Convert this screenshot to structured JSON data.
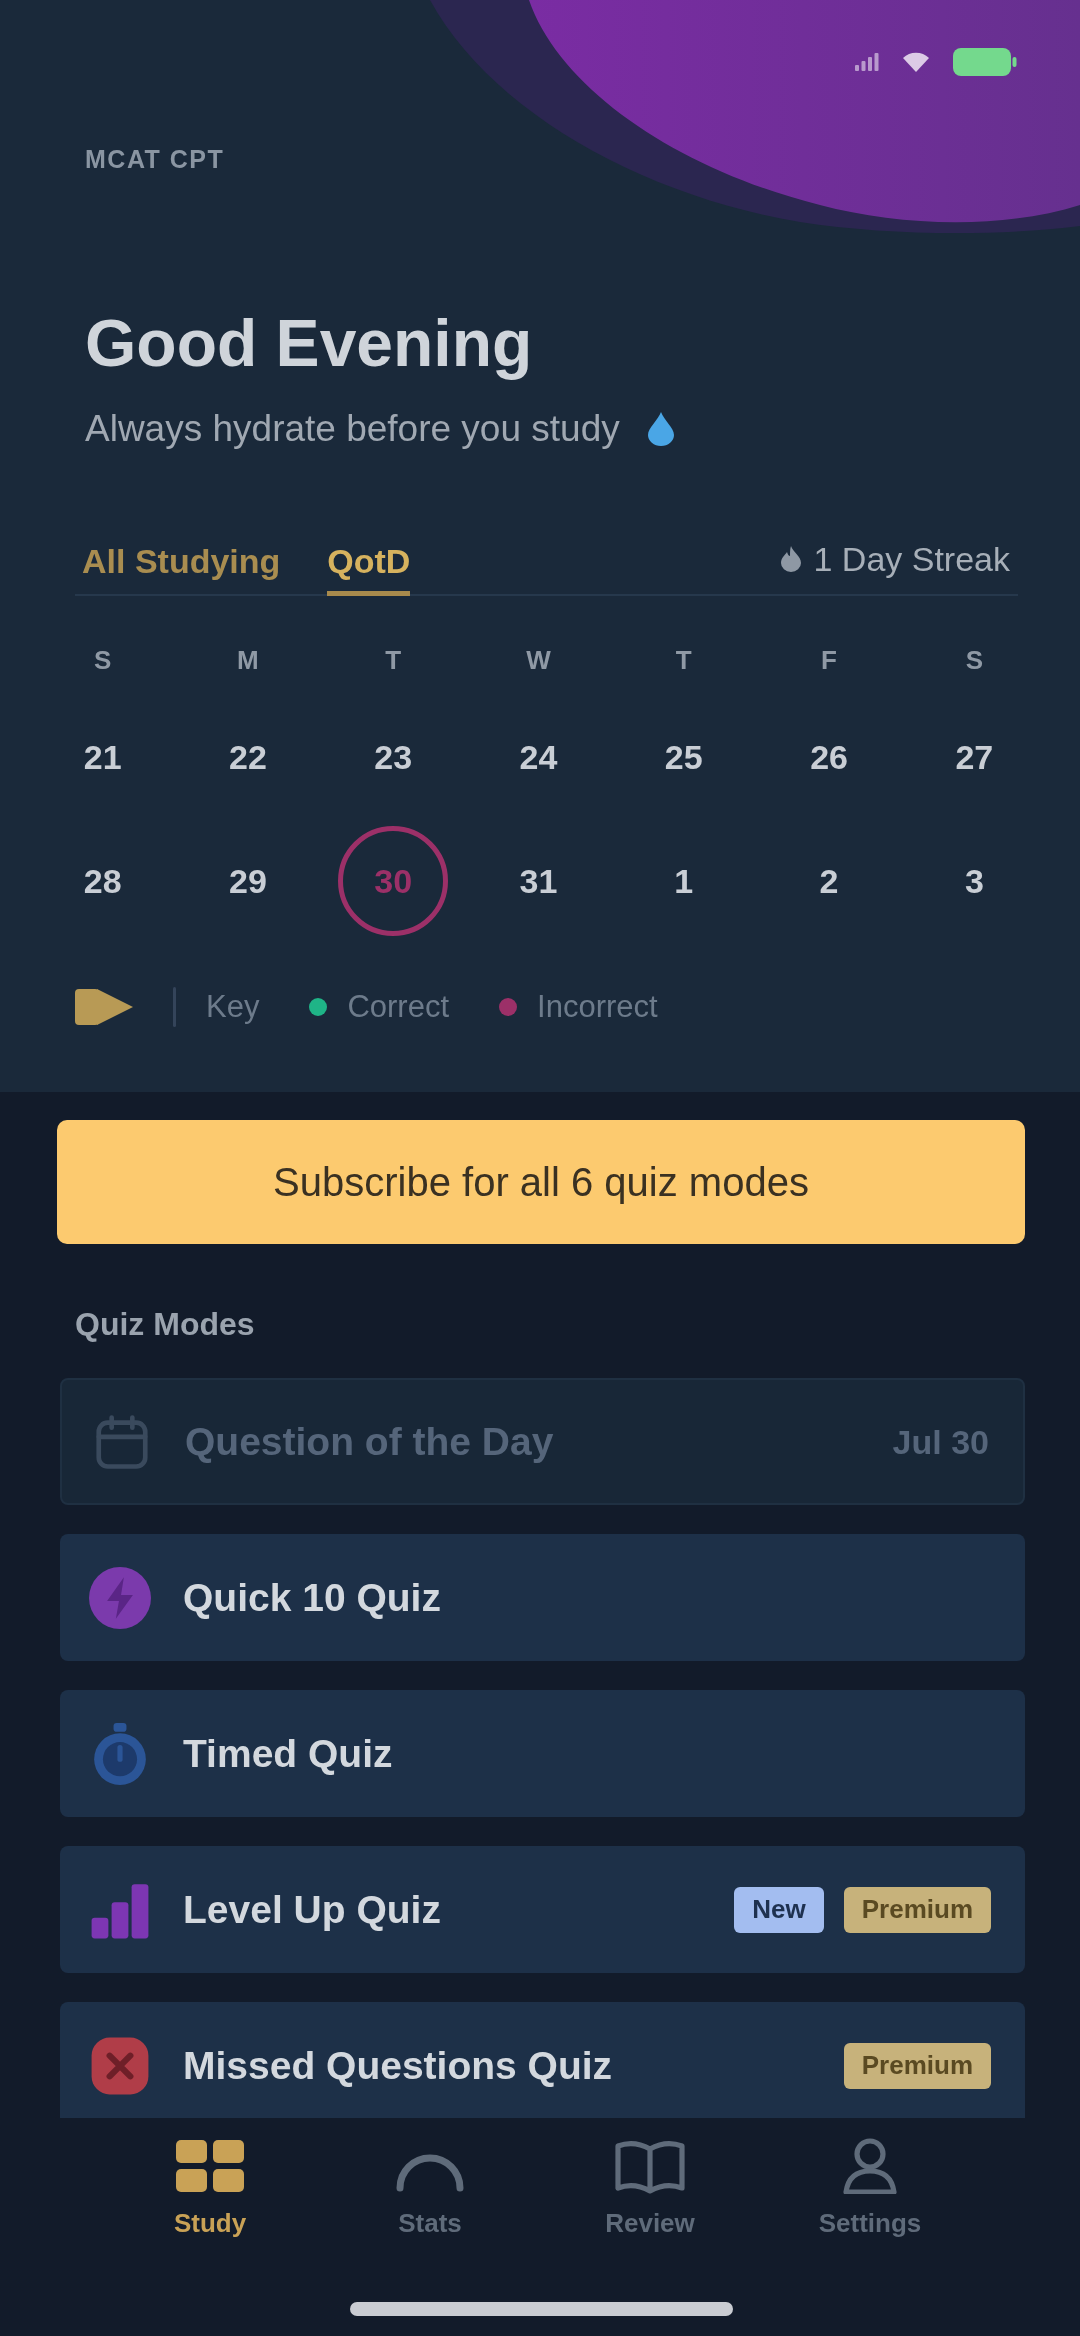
{
  "header": {
    "caption": "MCAT CPT",
    "greeting": "Good Evening",
    "tip": "Always hydrate before you study"
  },
  "tabs": [
    {
      "label": "All Studying",
      "selected": false
    },
    {
      "label": "QotD",
      "selected": true
    }
  ],
  "streak": {
    "label": "1 Day Streak"
  },
  "calendar": {
    "weekdays": [
      "S",
      "M",
      "T",
      "W",
      "T",
      "F",
      "S"
    ],
    "days": [
      {
        "label": "21",
        "incorrect": false
      },
      {
        "label": "22",
        "incorrect": false
      },
      {
        "label": "23",
        "incorrect": false
      },
      {
        "label": "24",
        "incorrect": false
      },
      {
        "label": "25",
        "incorrect": false
      },
      {
        "label": "26",
        "incorrect": false
      },
      {
        "label": "27",
        "incorrect": false
      },
      {
        "label": "28",
        "incorrect": false
      },
      {
        "label": "29",
        "incorrect": false
      },
      {
        "label": "30",
        "incorrect": true
      },
      {
        "label": "31",
        "incorrect": false
      },
      {
        "label": "1",
        "incorrect": false
      },
      {
        "label": "2",
        "incorrect": false
      },
      {
        "label": "3",
        "incorrect": false
      }
    ]
  },
  "legend": {
    "title": "Key",
    "items": [
      {
        "kind": "correct",
        "label": "Correct",
        "color": "#1fb487"
      },
      {
        "kind": "incorrect",
        "label": "Incorrect",
        "color": "#9c3068"
      }
    ]
  },
  "subscribe_button": {
    "label": "Subscribe for all 6 quiz modes"
  },
  "quiz_modes": {
    "title": "Quiz Modes",
    "items": [
      {
        "kind": "daily",
        "label": "Question of the Day",
        "date": "Jul 30",
        "disabled": true
      },
      {
        "kind": "quick",
        "label": "Quick 10 Quiz",
        "disabled": false
      },
      {
        "kind": "timed",
        "label": "Timed Quiz",
        "disabled": false
      },
      {
        "kind": "levelup",
        "label": "Level Up Quiz",
        "disabled": false,
        "badges": [
          {
            "kind": "new",
            "label": "New"
          },
          {
            "kind": "premium",
            "label": "Premium"
          }
        ]
      },
      {
        "kind": "missed",
        "label": "Missed Questions Quiz",
        "disabled": false,
        "badges": [
          {
            "kind": "premium",
            "label": "Premium"
          }
        ]
      }
    ]
  },
  "tab_bar": [
    {
      "kind": "study",
      "label": "Study",
      "selected": true
    },
    {
      "kind": "stats",
      "label": "Stats",
      "selected": false
    },
    {
      "kind": "review",
      "label": "Review",
      "selected": false
    },
    {
      "kind": "settings",
      "label": "Settings",
      "selected": false
    }
  ]
}
